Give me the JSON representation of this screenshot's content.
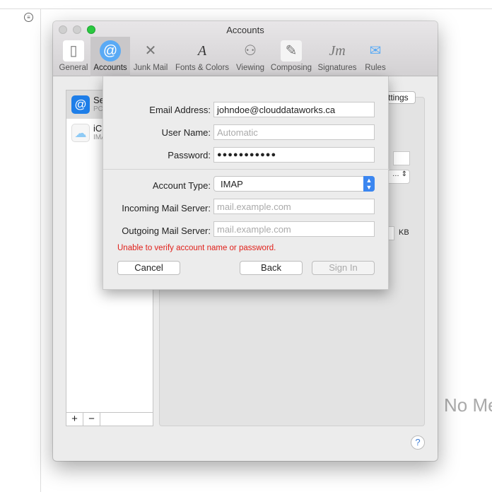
{
  "window": {
    "title": "Accounts"
  },
  "toolbar": [
    {
      "label": "General",
      "icon": "switch-icon"
    },
    {
      "label": "Accounts",
      "icon": "at-icon",
      "selected": true
    },
    {
      "label": "Junk Mail",
      "icon": "trash-icon"
    },
    {
      "label": "Fonts & Colors",
      "icon": "font-icon"
    },
    {
      "label": "Viewing",
      "icon": "glasses-icon"
    },
    {
      "label": "Composing",
      "icon": "pencil-icon"
    },
    {
      "label": "Signatures",
      "icon": "signature-icon"
    },
    {
      "label": "Rules",
      "icon": "rules-icon"
    }
  ],
  "accounts": [
    {
      "name": "Se",
      "type": "PO"
    },
    {
      "name": "iCl",
      "type": "IMA"
    }
  ],
  "list_buttons": {
    "add": "+",
    "remove": "−"
  },
  "pane": {
    "settings_fragment": "ttings",
    "unit": "KB"
  },
  "background": {
    "no_message": "No Me"
  },
  "sheet": {
    "email_label": "Email Address:",
    "email_value": "johndoe@clouddataworks.ca",
    "username_label": "User Name:",
    "username_placeholder": "Automatic",
    "password_label": "Password:",
    "password_value": "●●●●●●●●●●●",
    "account_type_label": "Account Type:",
    "account_type_value": "IMAP",
    "incoming_label": "Incoming Mail Server:",
    "incoming_placeholder": "mail.example.com",
    "outgoing_label": "Outgoing Mail Server:",
    "outgoing_placeholder": "mail.example.com",
    "error": "Unable to verify account name or password.",
    "cancel": "Cancel",
    "back": "Back",
    "sign_in": "Sign In"
  },
  "colors": {
    "error": "#e0201a",
    "accent": "#3b86f0"
  }
}
